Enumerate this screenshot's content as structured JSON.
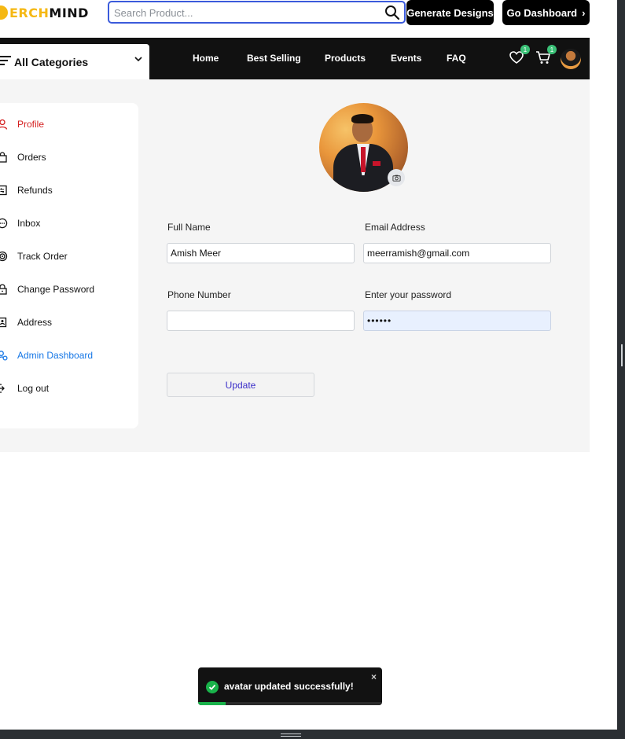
{
  "header": {
    "logo_prefix": "ERCH",
    "logo_suffix": "MIND",
    "search_placeholder": "Search Product...",
    "generate_label": "Generate Designs",
    "dashboard_label": "Go Dashboard"
  },
  "nav": {
    "categories_label": "All Categories",
    "items": [
      {
        "label": "Home"
      },
      {
        "label": "Best Selling"
      },
      {
        "label": "Products"
      },
      {
        "label": "Events"
      },
      {
        "label": "FAQ"
      }
    ],
    "wishlist_count": "1",
    "cart_count": "1"
  },
  "sidebar": {
    "items": [
      {
        "label": "Profile",
        "icon": "person-icon"
      },
      {
        "label": "Orders",
        "icon": "bag-icon"
      },
      {
        "label": "Refunds",
        "icon": "receipt-icon"
      },
      {
        "label": "Inbox",
        "icon": "chat-icon"
      },
      {
        "label": "Track Order",
        "icon": "target-icon"
      },
      {
        "label": "Change Password",
        "icon": "lock-icon"
      },
      {
        "label": "Address",
        "icon": "address-book-icon"
      },
      {
        "label": "Admin Dashboard",
        "icon": "admin-icon"
      },
      {
        "label": "Log out",
        "icon": "logout-icon"
      }
    ]
  },
  "form": {
    "full_name_label": "Full Name",
    "full_name_value": "Amish Meer",
    "email_label": "Email Address",
    "email_value": "meerramish@gmail.com",
    "phone_label": "Phone Number",
    "phone_value": "",
    "password_label": "Enter your password",
    "password_value": "••••••",
    "update_label": "Update"
  },
  "toast": {
    "message": "avatar updated successfully!",
    "close": "×",
    "progress": 0.15
  },
  "colors": {
    "brand_yellow": "#f5b814",
    "active_red": "#d41f1f",
    "admin_blue": "#1677e6",
    "success_green": "#19b34a"
  }
}
